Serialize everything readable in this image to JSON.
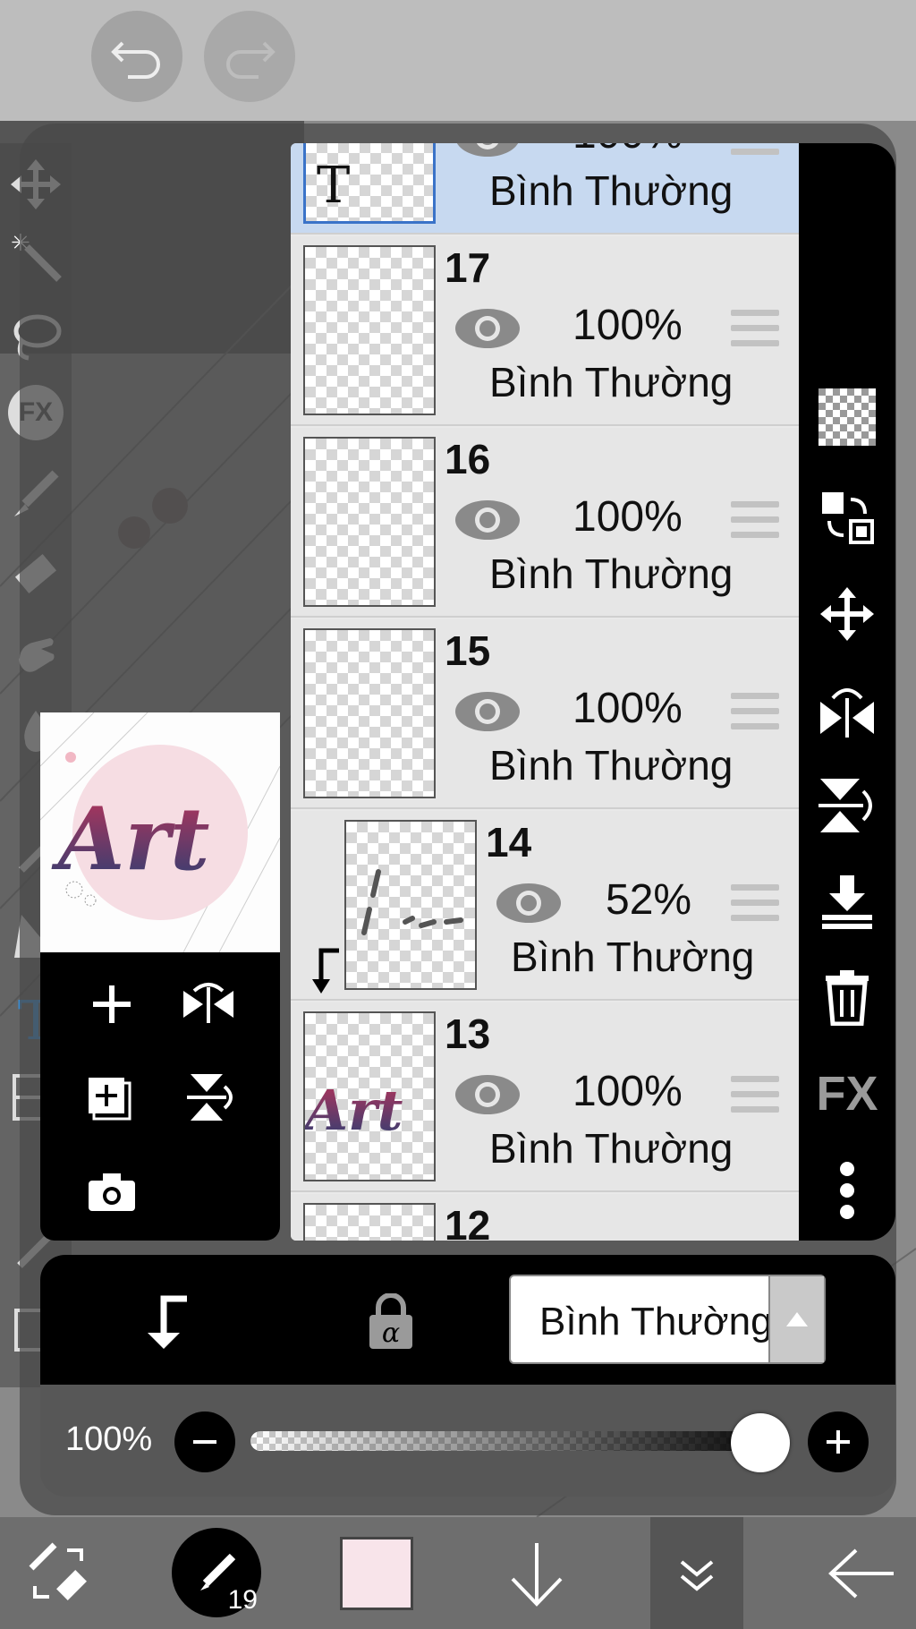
{
  "app": {
    "undo_icon": "undo-arrow-icon",
    "redo_icon": "redo-arrow-icon"
  },
  "preview": {
    "art_text": "Art",
    "colors": {
      "circle": "#f6dde3",
      "text_top": "#b8345a",
      "text_bottom": "#2c3f73"
    }
  },
  "layers": [
    {
      "number": "",
      "opacity": "100%",
      "blend": "Bình Thường",
      "selected": true,
      "type": "text",
      "thumb_glyph": "T"
    },
    {
      "number": "17",
      "opacity": "100%",
      "blend": "Bình Thường",
      "selected": false
    },
    {
      "number": "16",
      "opacity": "100%",
      "blend": "Bình Thường",
      "selected": false
    },
    {
      "number": "15",
      "opacity": "100%",
      "blend": "Bình Thường",
      "selected": false
    },
    {
      "number": "14",
      "opacity": "52%",
      "blend": "Bình Thường",
      "selected": false,
      "clipped": true
    },
    {
      "number": "13",
      "opacity": "100%",
      "blend": "Bình Thường",
      "selected": false,
      "thumb_text": "Art"
    },
    {
      "number": "12",
      "opacity": "",
      "blend": "",
      "selected": false
    }
  ],
  "right_tools": [
    "checker-icon",
    "swap-layer-icon",
    "move-icon",
    "flip-horizontal-icon",
    "flip-vertical-icon",
    "merge-down-icon",
    "trash-icon",
    "fx-label",
    "more-vertical-icon"
  ],
  "right_tools_fx_label": "FX",
  "left_tools_fx_label": "FX",
  "blend_mode": {
    "current": "Bình Thường"
  },
  "opacity": {
    "label": "100%",
    "value": 1.0
  },
  "bottom_bar": {
    "brush_size": "19",
    "color": "#f8e4ea"
  }
}
